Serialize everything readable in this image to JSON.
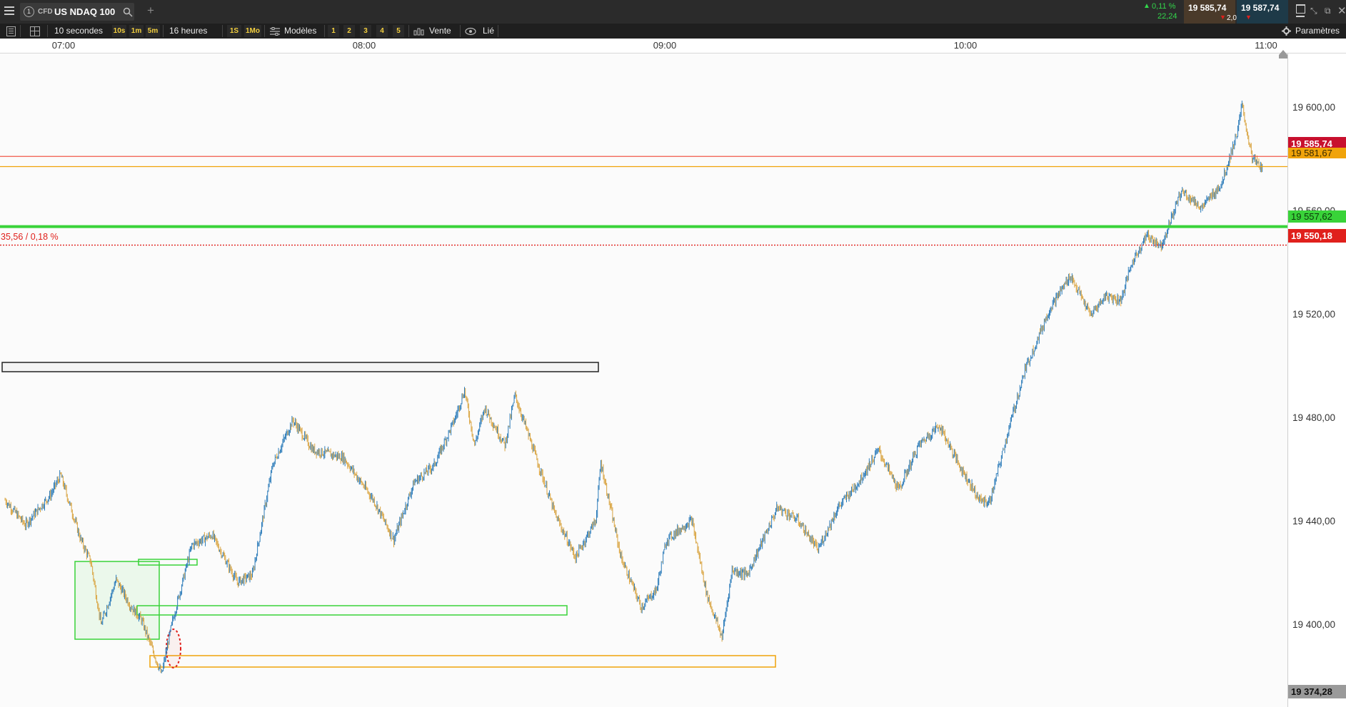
{
  "window": {
    "instrument_number": "1",
    "instrument_type": "CFD",
    "instrument_name": "US NDAQ 100",
    "add_tab": "+"
  },
  "quote": {
    "change_pct": "0,11 %",
    "change_abs": "22,24",
    "bid": "19 585,74",
    "spread": "2,00",
    "ask": "19 587,74"
  },
  "toolbar": {
    "interval": "10 secondes",
    "quick_intervals": [
      "10s",
      "1m",
      "5m"
    ],
    "range": "16 heures",
    "quick_ranges": [
      "1S",
      "1Mo"
    ],
    "templates_label": "Modèles",
    "layouts": [
      "1",
      "2",
      "3",
      "4",
      "5"
    ],
    "order_label": "Vente",
    "link_label": "Lié",
    "settings_label": "Paramètres"
  },
  "time_axis": [
    "07:00",
    "08:00",
    "09:00",
    "10:00",
    "11:00"
  ],
  "price_axis": [
    "19 600,00",
    "19 560,00",
    "19 520,00",
    "19 480,00",
    "19 440,00",
    "19 400,00"
  ],
  "price_tags": {
    "bid": "19 585,74",
    "orange_line": "19 581,67",
    "green_line": "19 557,62",
    "reference": "19 550,18",
    "bottom": "19 374,28"
  },
  "annotation": "35,56 / 0,18 %",
  "colors": {
    "bid_tag": "#c8102e",
    "orange_line": "#f0a30a",
    "green_line": "#39d339",
    "reference": "#e0201c",
    "up_candle": "#2b7bb9",
    "down_candle": "#d9a441"
  },
  "chart_data": {
    "type": "candlestick",
    "x_range": [
      "06:50",
      "11:05"
    ],
    "y_range": [
      19365,
      19627
    ],
    "key_path": [
      [
        "06:51",
        19448
      ],
      [
        "06:55",
        19438
      ],
      [
        "07:00",
        19450
      ],
      [
        "07:02",
        19458
      ],
      [
        "07:06",
        19432
      ],
      [
        "07:08",
        19423
      ],
      [
        "07:10",
        19398
      ],
      [
        "07:13",
        19416
      ],
      [
        "07:16",
        19405
      ],
      [
        "07:18",
        19400
      ],
      [
        "07:22",
        19378
      ],
      [
        "07:24",
        19398
      ],
      [
        "07:28",
        19430
      ],
      [
        "07:32",
        19434
      ],
      [
        "07:37",
        19415
      ],
      [
        "07:40",
        19418
      ],
      [
        "07:44",
        19462
      ],
      [
        "07:48",
        19480
      ],
      [
        "07:52",
        19468
      ],
      [
        "07:58",
        19465
      ],
      [
        "08:04",
        19448
      ],
      [
        "08:08",
        19432
      ],
      [
        "08:12",
        19455
      ],
      [
        "08:16",
        19462
      ],
      [
        "08:20",
        19480
      ],
      [
        "08:22",
        19492
      ],
      [
        "08:24",
        19470
      ],
      [
        "08:26",
        19485
      ],
      [
        "08:30",
        19470
      ],
      [
        "08:32",
        19490
      ],
      [
        "08:37",
        19460
      ],
      [
        "08:40",
        19442
      ],
      [
        "08:44",
        19425
      ],
      [
        "08:48",
        19440
      ],
      [
        "08:49",
        19463
      ],
      [
        "08:53",
        19425
      ],
      [
        "08:57",
        19405
      ],
      [
        "09:00",
        19412
      ],
      [
        "09:02",
        19432
      ],
      [
        "09:07",
        19440
      ],
      [
        "09:10",
        19410
      ],
      [
        "09:13",
        19393
      ],
      [
        "09:15",
        19420
      ],
      [
        "09:18",
        19418
      ],
      [
        "09:24",
        19445
      ],
      [
        "09:28",
        19440
      ],
      [
        "09:32",
        19428
      ],
      [
        "09:36",
        19445
      ],
      [
        "09:40",
        19455
      ],
      [
        "09:44",
        19468
      ],
      [
        "09:48",
        19452
      ],
      [
        "09:52",
        19470
      ],
      [
        "09:56",
        19478
      ],
      [
        "10:00",
        19462
      ],
      [
        "10:04",
        19448
      ],
      [
        "10:06",
        19447
      ],
      [
        "10:10",
        19478
      ],
      [
        "10:13",
        19500
      ],
      [
        "10:18",
        19525
      ],
      [
        "10:22",
        19538
      ],
      [
        "10:26",
        19522
      ],
      [
        "10:29",
        19530
      ],
      [
        "10:32",
        19528
      ],
      [
        "10:34",
        19542
      ],
      [
        "10:37",
        19554
      ],
      [
        "10:40",
        19550
      ],
      [
        "10:44",
        19572
      ],
      [
        "10:48",
        19565
      ],
      [
        "10:52",
        19575
      ],
      [
        "10:55",
        19595
      ],
      [
        "10:56",
        19606
      ],
      [
        "10:58",
        19585
      ],
      [
        "11:00",
        19581
      ]
    ],
    "horizontal_lines": [
      {
        "price": 19585.74,
        "color": "#f05a4a",
        "style": "solid"
      },
      {
        "price": 19581.67,
        "color": "#f0a30a",
        "style": "solid"
      },
      {
        "price": 19557.62,
        "color": "#39d339",
        "style": "thick"
      },
      {
        "price": 19550.18,
        "color": "#e0201c",
        "style": "dotted"
      }
    ]
  }
}
